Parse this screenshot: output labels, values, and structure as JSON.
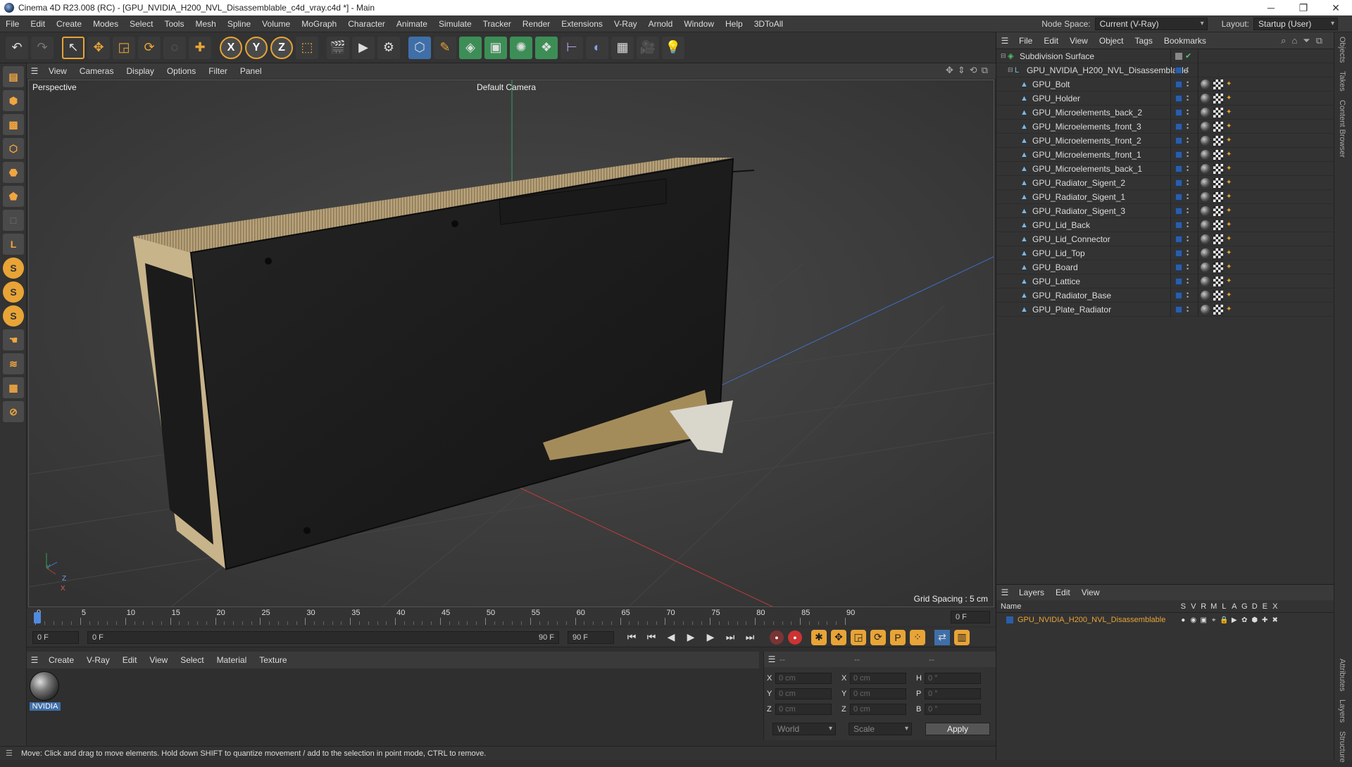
{
  "window": {
    "title": "Cinema 4D R23.008 (RC) - [GPU_NVIDIA_H200_NVL_Disassemblable_c4d_vray.c4d *] - Main",
    "minimize": "─",
    "maximize": "❐",
    "close": "✕"
  },
  "menubar": {
    "items": [
      "File",
      "Edit",
      "Create",
      "Modes",
      "Select",
      "Tools",
      "Mesh",
      "Spline",
      "Volume",
      "MoGraph",
      "Character",
      "Animate",
      "Simulate",
      "Tracker",
      "Render",
      "Extensions",
      "V-Ray",
      "Arnold",
      "Window",
      "Help",
      "3DToAll"
    ],
    "node_space_label": "Node Space:",
    "node_space_value": "Current (V-Ray)",
    "layout_label": "Layout:",
    "layout_value": "Startup (User)"
  },
  "toolbar": {
    "x_label": "X",
    "y_label": "Y",
    "z_label": "Z"
  },
  "viewport_menu": [
    "View",
    "Cameras",
    "Display",
    "Options",
    "Filter",
    "Panel"
  ],
  "viewport": {
    "name": "Perspective",
    "camera": "Default Camera",
    "grid_spacing": "Grid Spacing : 5 cm",
    "axis_y": "Y",
    "axis_z": "Z",
    "axis_x": "X"
  },
  "timeline": {
    "ticks": [
      "0",
      "5",
      "10",
      "15",
      "20",
      "25",
      "30",
      "35",
      "40",
      "45",
      "50",
      "55",
      "60",
      "65",
      "70",
      "75",
      "80",
      "85",
      "90"
    ],
    "current_frame": "0 F"
  },
  "transport": {
    "start_frame": "0 F",
    "range_start": "0 F",
    "range_end": "90 F",
    "end_frame": "90 F"
  },
  "material_menu": [
    "Create",
    "V-Ray",
    "Edit",
    "View",
    "Select",
    "Material",
    "Texture"
  ],
  "material": {
    "name": "NVIDIA"
  },
  "coords": {
    "header_dashes": [
      "--",
      "--",
      "--"
    ],
    "rows": [
      {
        "a": "X",
        "av": "0 cm",
        "b": "X",
        "bv": "0 cm",
        "c": "H",
        "cv": "0 °"
      },
      {
        "a": "Y",
        "av": "0 cm",
        "b": "Y",
        "bv": "0 cm",
        "c": "P",
        "cv": "0 °"
      },
      {
        "a": "Z",
        "av": "0 cm",
        "b": "Z",
        "bv": "0 cm",
        "c": "B",
        "cv": "0 °"
      }
    ],
    "mode": "World",
    "scale": "Scale",
    "apply": "Apply"
  },
  "status": "Move: Click and drag to move elements. Hold down SHIFT to quantize movement / add to the selection in point mode, CTRL to remove.",
  "objects_menu": [
    "File",
    "Edit",
    "View",
    "Object",
    "Tags",
    "Bookmarks"
  ],
  "objects": {
    "root": "Subdivision Surface",
    "group": "GPU_NVIDIA_H200_NVL_Disassemblable",
    "children": [
      "GPU_Bolt",
      "GPU_Holder",
      "GPU_Microelements_back_2",
      "GPU_Microelements_front_3",
      "GPU_Microelements_front_2",
      "GPU_Microelements_front_1",
      "GPU_Microelements_back_1",
      "GPU_Radiator_Sigent_2",
      "GPU_Radiator_Sigent_1",
      "GPU_Radiator_Sigent_3",
      "GPU_Lid_Back",
      "GPU_Lid_Connector",
      "GPU_Lid_Top",
      "GPU_Board",
      "GPU_Lattice",
      "GPU_Radiator_Base",
      "GPU_Plate_Radiator"
    ]
  },
  "side_tabs": [
    "Objects",
    "Takes",
    "Content Browser",
    "Attributes",
    "Layers",
    "Structure"
  ],
  "layers_menu": [
    "Layers",
    "Edit",
    "View"
  ],
  "layers": {
    "col_name": "Name",
    "cols": [
      "S",
      "V",
      "R",
      "M",
      "L",
      "A",
      "G",
      "D",
      "E",
      "X"
    ],
    "rows": [
      "GPU_NVIDIA_H200_NVL_Disassemblable"
    ]
  }
}
